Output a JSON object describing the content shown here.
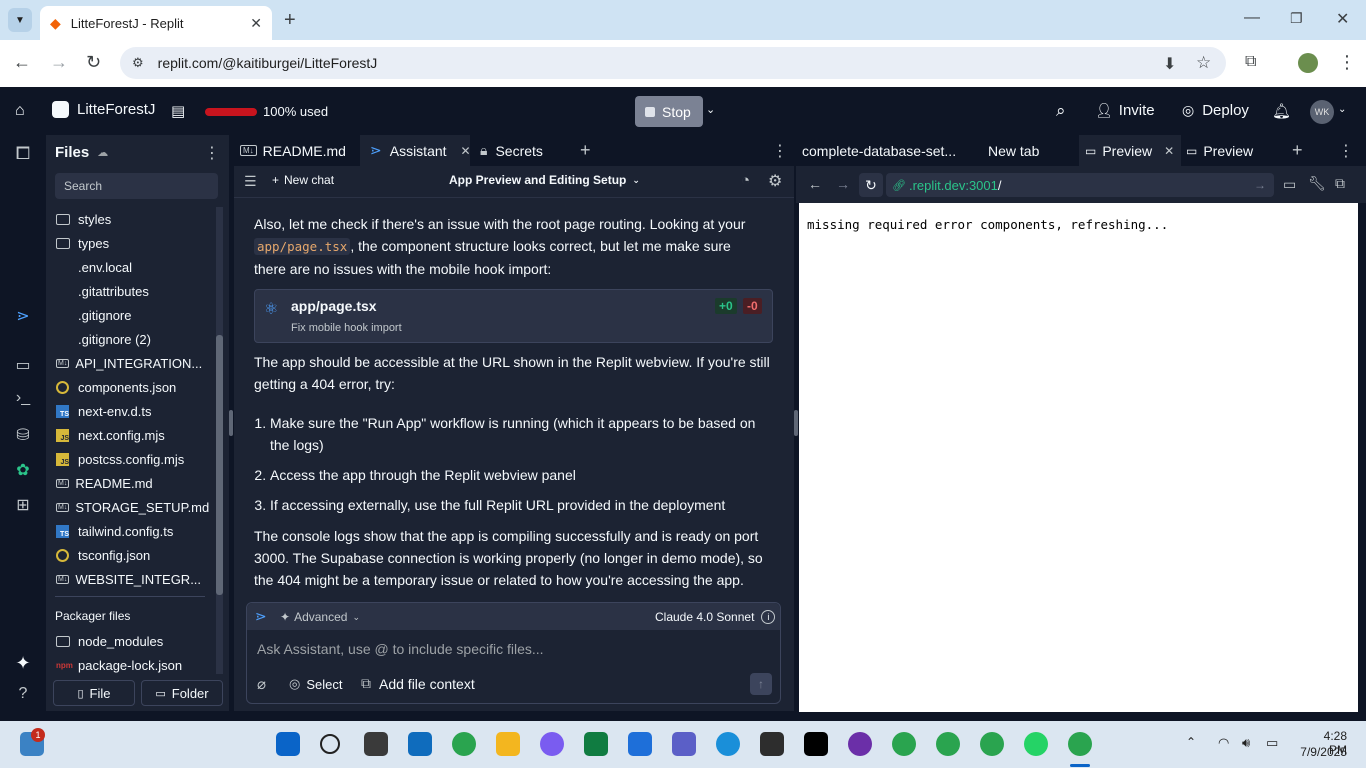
{
  "browser": {
    "tab_title": "LitteForestJ - Replit",
    "url": "replit.com/@kaitiburgei/LitteForestJ"
  },
  "topbar": {
    "project_name": "LitteForestJ",
    "usage": "100% used",
    "stop_label": "Stop",
    "invite_label": "Invite",
    "deploy_label": "Deploy",
    "avatar": "WK"
  },
  "files": {
    "title": "Files",
    "search_placeholder": "Search",
    "items": [
      {
        "name": "styles",
        "type": "folder"
      },
      {
        "name": "types",
        "type": "folder"
      },
      {
        "name": ".env.local",
        "type": "file"
      },
      {
        "name": ".gitattributes",
        "type": "file"
      },
      {
        "name": ".gitignore",
        "type": "file"
      },
      {
        "name": ".gitignore (2)",
        "type": "file"
      },
      {
        "name": "API_INTEGRATION...",
        "type": "md"
      },
      {
        "name": "components.json",
        "type": "json"
      },
      {
        "name": "next-env.d.ts",
        "type": "ts"
      },
      {
        "name": "next.config.mjs",
        "type": "js"
      },
      {
        "name": "postcss.config.mjs",
        "type": "js"
      },
      {
        "name": "README.md",
        "type": "md"
      },
      {
        "name": "STORAGE_SETUP.md",
        "type": "md"
      },
      {
        "name": "tailwind.config.ts",
        "type": "ts"
      },
      {
        "name": "tsconfig.json",
        "type": "json"
      },
      {
        "name": "WEBSITE_INTEGR...",
        "type": "md"
      }
    ],
    "packager_title": "Packager files",
    "packager_items": [
      "node_modules",
      "package-lock.json"
    ],
    "file_button": "File",
    "folder_button": "Folder"
  },
  "assistant": {
    "tabs": [
      "README.md",
      "Assistant",
      "Secrets"
    ],
    "new_chat": "New chat",
    "chat_title": "App Preview and Editing Setup",
    "para1_a": "Also, let me check if there's an issue with the root page routing. Looking at your",
    "para1_code": "app/page.tsx",
    "para1_b": ", the component structure looks correct, but let me make sure",
    "para1_c": "there are no issues with the mobile hook import:",
    "file_card": {
      "name": "app/page.tsx",
      "desc": "Fix mobile hook import",
      "added": "+0",
      "removed": "-0"
    },
    "para2": "The app should be accessible at the URL shown in the Replit webview. If you're still getting a 404 error, try:",
    "steps": [
      "Make sure the \"Run App\" workflow is running (which it appears to be based on the logs)",
      "Access the app through the Replit webview panel",
      "If accessing externally, use the full Replit URL provided in the deployment"
    ],
    "para3": "The console logs show that the app is compiling successfully and is ready on port 3000. The Supabase connection is working properly (no longer in demo mode), so the 404 might be a temporary issue or related to how you're accessing the app.",
    "advanced": "Advanced",
    "model": "Claude 4.0 Sonnet",
    "input_placeholder": "Ask Assistant, use @ to include specific files...",
    "select_label": "Select",
    "add_context": "Add file context"
  },
  "preview": {
    "tabs": [
      "complete-database-set...",
      "New tab",
      "Preview",
      "Preview"
    ],
    "url_host": ".replit.dev:3001",
    "url_path": "/",
    "message": "missing required error components, refreshing..."
  },
  "taskbar": {
    "time": "4:28 PM",
    "date": "7/9/2025",
    "notif_badge": "1"
  }
}
